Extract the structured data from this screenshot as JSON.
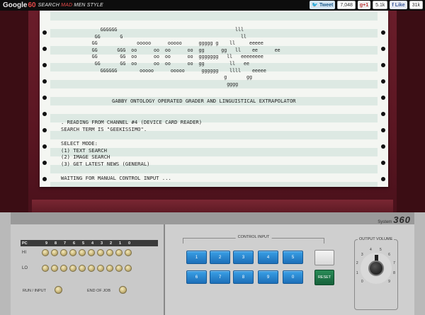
{
  "topbar": {
    "brand": "Google",
    "brand_accent": "60",
    "tagline_pre": "SEARCH ",
    "tagline_accent": "MAD",
    "tagline_post": " MEN STYLE",
    "tweet_label": "Tweet",
    "tweet_count": "7,048",
    "gplus_label": "+1",
    "gplus_count": "5.1k",
    "fb_label": "Like",
    "fb_count": "31k"
  },
  "printout": {
    "logo_lines": [
      "              GGGGGG                                          lll",
      "            GG       G                                          ll",
      "           GG              ooooo      ooooo      ggggg g    ll     eeeee",
      "           GG       GGG  oo      oo  oo      oo  gg      gg   ll    ee      ee",
      "           GG        GG  oo      oo  oo      oo  ggggggg   ll   eeeeeeee",
      "            GG       GG  oo      oo  oo      oo  gg         ll   ee",
      "              GGGGGG        ooooo      ooooo      gggggg    llll    eeeee",
      "                                                          g       gg",
      "                                                           gggg"
    ],
    "subtitle": "GABBY ONTOLOGY OPERATED GRADER AND LINGUISTICAL EXTRAPOLATOR",
    "line1": ". READING FROM CHANNEL #4 (DEVICE CARD READER)",
    "line2": "SEARCH TERM IS \"GEEKISSIMO\".",
    "line3": "SELECT MODE:",
    "line4": "(1) TEXT SEARCH",
    "line5": "(2) IMAGE SEARCH",
    "line6": "(3) GET LATEST NEWS (GENERAL)",
    "line7": "WAITING FOR MANUAL CONTROL INPUT ..."
  },
  "system": {
    "prefix": "System",
    "model": "360"
  },
  "left_panel": {
    "pc_label": "PC",
    "bit_numbers": [
      "9",
      "8",
      "7",
      "6",
      "5",
      "4",
      "3",
      "2",
      "1",
      "0"
    ],
    "hi_label": "HI",
    "lo_label": "LO",
    "run_label": "RUN / INPUT",
    "end_label": "END OF JOB"
  },
  "control": {
    "label": "CONTROL INPUT",
    "keys": [
      "1",
      "2",
      "3",
      "4",
      "5",
      "6",
      "7",
      "8",
      "9",
      "0"
    ],
    "reset_label": "RESET"
  },
  "volume": {
    "label": "OUTPUT VOLUME",
    "numbers": [
      "0",
      "1",
      "2",
      "3",
      "4",
      "5",
      "6",
      "7",
      "8",
      "9"
    ],
    "level": "3"
  }
}
